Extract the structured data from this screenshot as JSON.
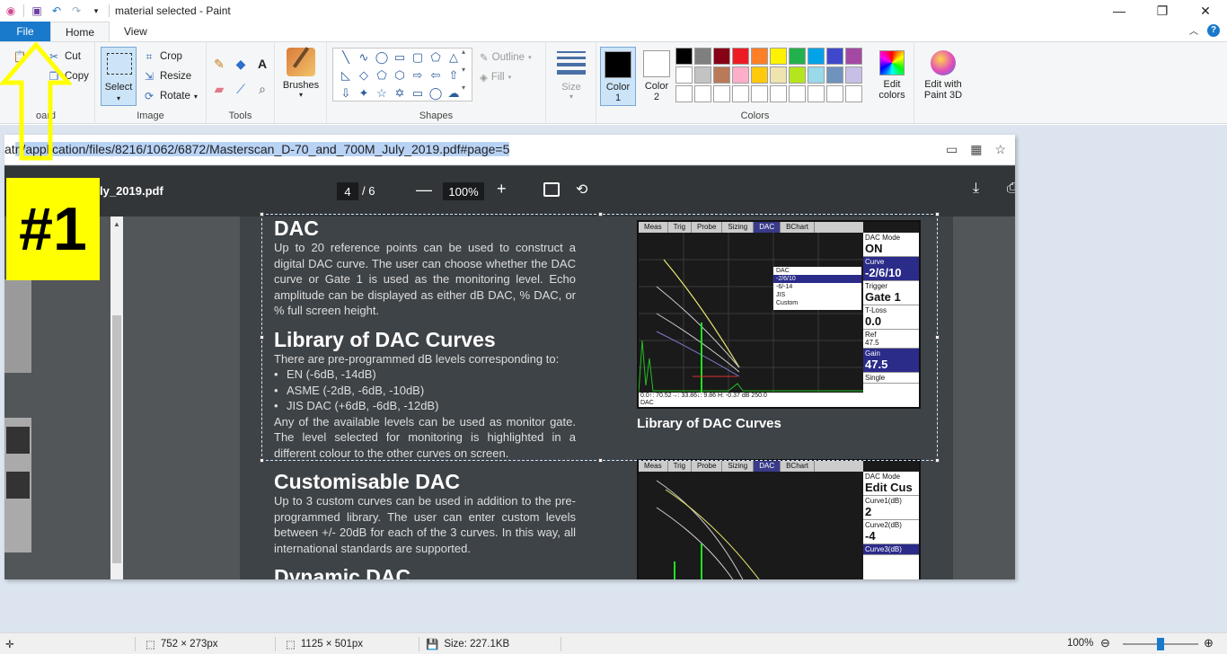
{
  "window": {
    "title": "material selected - Paint",
    "minimize": "—",
    "maximize": "❐",
    "close": "✕"
  },
  "quick_access": {
    "save_icon": "save-icon",
    "undo_icon": "undo-icon",
    "redo_icon": "redo-icon"
  },
  "tabs": {
    "file": "File",
    "home": "Home",
    "view": "View"
  },
  "ribbon": {
    "clipboard": {
      "cut": "Cut",
      "copy": "Copy",
      "label": "oard"
    },
    "image": {
      "select": "Select",
      "crop": "Crop",
      "resize": "Resize",
      "rotate": "Rotate",
      "label": "Image"
    },
    "tools": {
      "label": "Tools"
    },
    "brushes": {
      "label": "Brushes"
    },
    "shapes": {
      "outline": "Outline",
      "fill": "Fill",
      "label": "Shapes"
    },
    "size": {
      "label": "Size"
    },
    "colors": {
      "color1_line1": "Color",
      "color1_line2": "1",
      "color2_line1": "Color",
      "color2_line2": "2",
      "edit_line1": "Edit",
      "edit_line2": "colors",
      "label": "Colors",
      "color1_value": "#000000",
      "color2_value": "#ffffff",
      "palette": [
        "#000000",
        "#7f7f7f",
        "#880015",
        "#ed1c24",
        "#ff7f27",
        "#fff200",
        "#22b14c",
        "#00a2e8",
        "#3f48cc",
        "#a349a4",
        "#ffffff",
        "#c3c3c3",
        "#b97a57",
        "#ffaec9",
        "#ffc90e",
        "#efe4b0",
        "#b5e61d",
        "#99d9ea",
        "#7092be",
        "#c8bfe7",
        "#ffffff",
        "#ffffff",
        "#ffffff",
        "#ffffff",
        "#ffffff",
        "#ffffff",
        "#ffffff",
        "#ffffff",
        "#ffffff",
        "#ffffff"
      ]
    },
    "paint3d": {
      "line1": "Edit with",
      "line2": "Paint 3D"
    }
  },
  "canvas": {
    "url_prefix": "at",
    "url_highlighted": "n/application/files/8216/1062/6872/Masterscan_D-70_and_700M_July_2019.pdf#page=5",
    "pdf_filename": "ly_2019.pdf",
    "page_current": "4",
    "page_total": "/  6",
    "zoom": "100%",
    "dac": {
      "heading": "DAC",
      "body": "Up to 20 reference points can be used to construct a digital DAC curve. The user can choose whether the DAC curve or Gate 1 is used as the monitoring level. Echo amplitude can be displayed as either dB DAC, % DAC, or % full screen height."
    },
    "library": {
      "heading": "Library of DAC Curves",
      "intro": "There are pre-programmed dB levels corresponding to:",
      "items": [
        "EN (-6dB, -14dB)",
        "ASME (-2dB, -6dB, -10dB)",
        "JIS DAC (+6dB, -6dB, -12dB)"
      ],
      "outro": "Any of the available levels can be used as monitor gate. The level selected for monitoring is highlighted in a different colour to the other curves on screen."
    },
    "custom": {
      "heading": "Customisable DAC",
      "body": "Up to 3 custom curves can be used in addition to the pre-programmed library. The user can enter custom levels between +/- 20dB for each of the 3 curves. In this way, all international standards are supported."
    },
    "dynamic": {
      "heading": "Dynamic DAC"
    },
    "screen1": {
      "tabs": [
        "Meas",
        "Trig",
        "Probe",
        "Sizing",
        "DAC",
        "BChart"
      ],
      "active_tab": "DAC",
      "side": [
        {
          "label": "DAC Mode",
          "value": "ON"
        },
        {
          "label": "Curve",
          "value": "-2/6/10"
        },
        {
          "label": "Trigger",
          "value": "Gate 1"
        },
        {
          "label": "T-Loss",
          "value": "0.0"
        },
        {
          "label": "Ref",
          "value": "47.5"
        },
        {
          "label": "Gain",
          "value": "47.5"
        }
      ],
      "menu": [
        "DAC",
        "-2/6/10",
        "-6/-14",
        "JIS",
        "Custom"
      ],
      "status": "0.0↑: 70.52→: 33.86↓: 9.86 H: -0.37 dB 250.0",
      "status2": "DAC",
      "single": "Single",
      "caption": "Library of DAC Curves"
    },
    "screen2": {
      "tabs": [
        "Meas",
        "Trig",
        "Probe",
        "Sizing",
        "DAC",
        "BChart"
      ],
      "active_tab": "DAC",
      "side": [
        {
          "label": "DAC Mode",
          "value": "Edit Cus"
        },
        {
          "label": "Curve1(dB)",
          "value": "2"
        },
        {
          "label": "Curve2(dB)",
          "value": "-4"
        },
        {
          "label": "Curve3(dB)",
          "value": ""
        }
      ]
    }
  },
  "annotation": {
    "badge": "#1"
  },
  "statusbar": {
    "selection_size": "752 × 273px",
    "image_size": "1125 × 501px",
    "file_size": "Size: 227.1KB",
    "zoom": "100%"
  }
}
